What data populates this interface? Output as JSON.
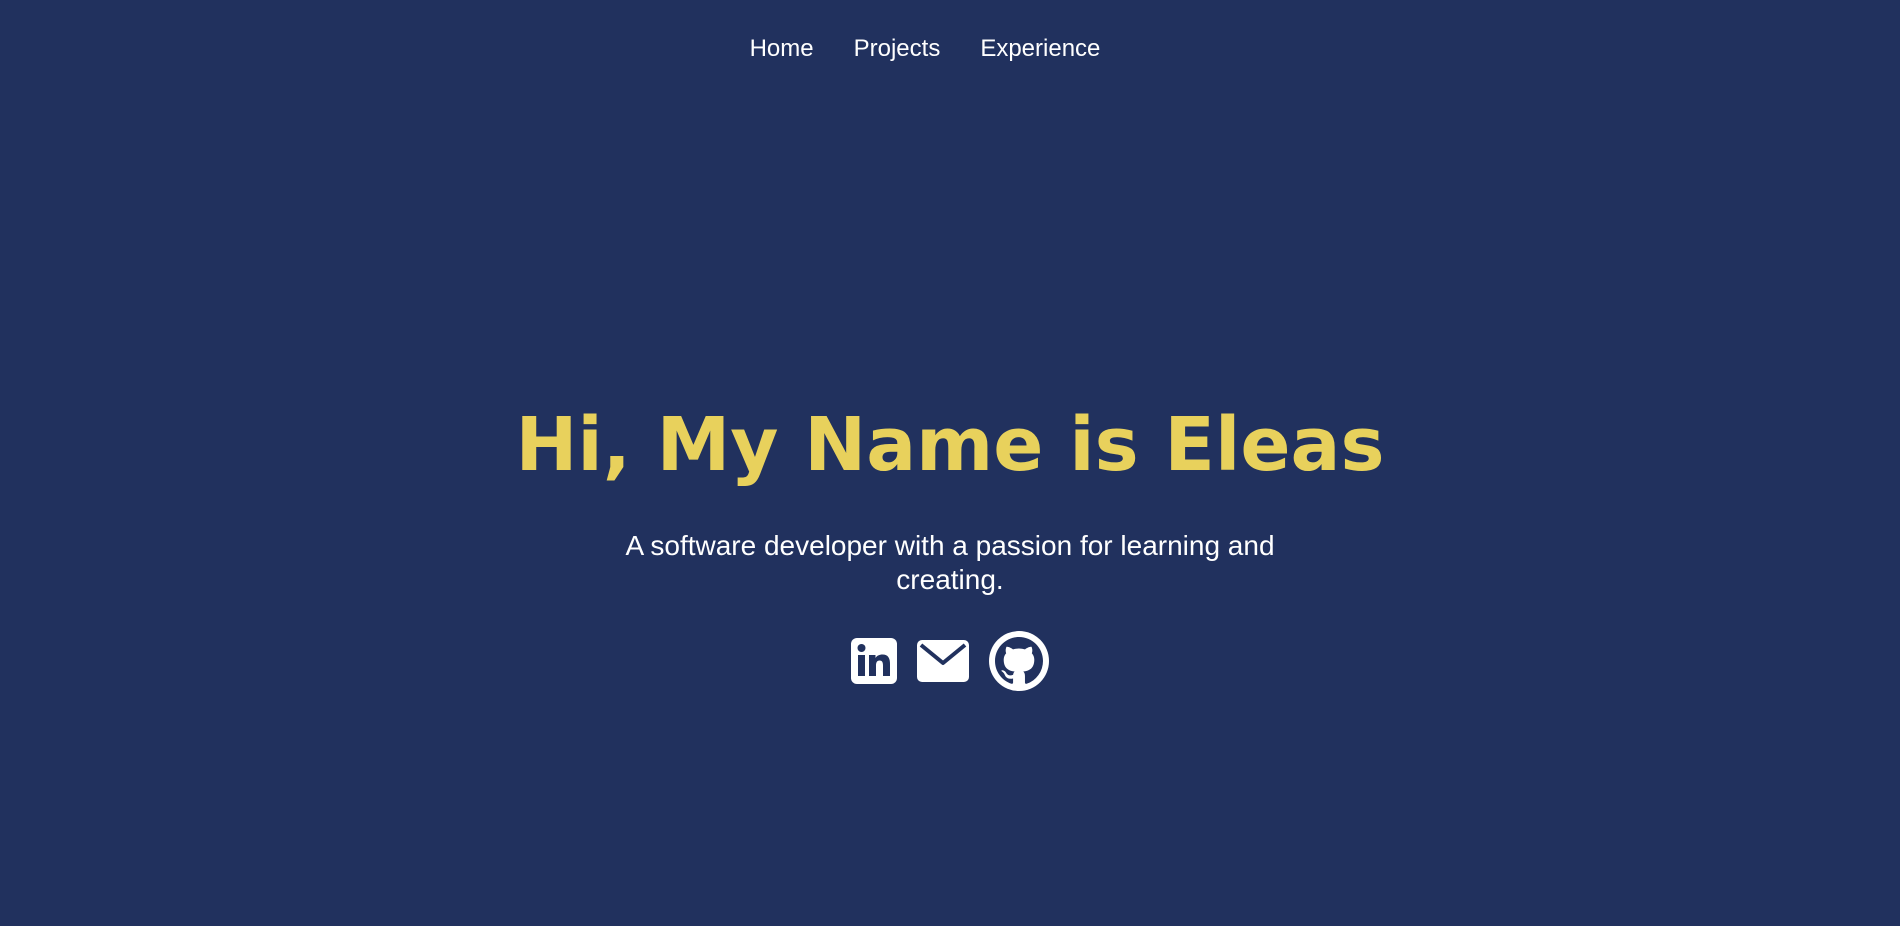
{
  "nav": {
    "items": [
      {
        "label": "Home"
      },
      {
        "label": "Projects"
      },
      {
        "label": "Experience"
      }
    ]
  },
  "hero": {
    "title": "Hi, My Name is Eleas",
    "subtitle": "A software developer with a passion for learning and creating."
  },
  "socials": [
    {
      "icon": "linkedin-icon"
    },
    {
      "icon": "email-icon"
    },
    {
      "icon": "github-icon"
    }
  ],
  "colors": {
    "background": "#21315e",
    "accent": "#e8d15c",
    "text": "#ffffff"
  }
}
